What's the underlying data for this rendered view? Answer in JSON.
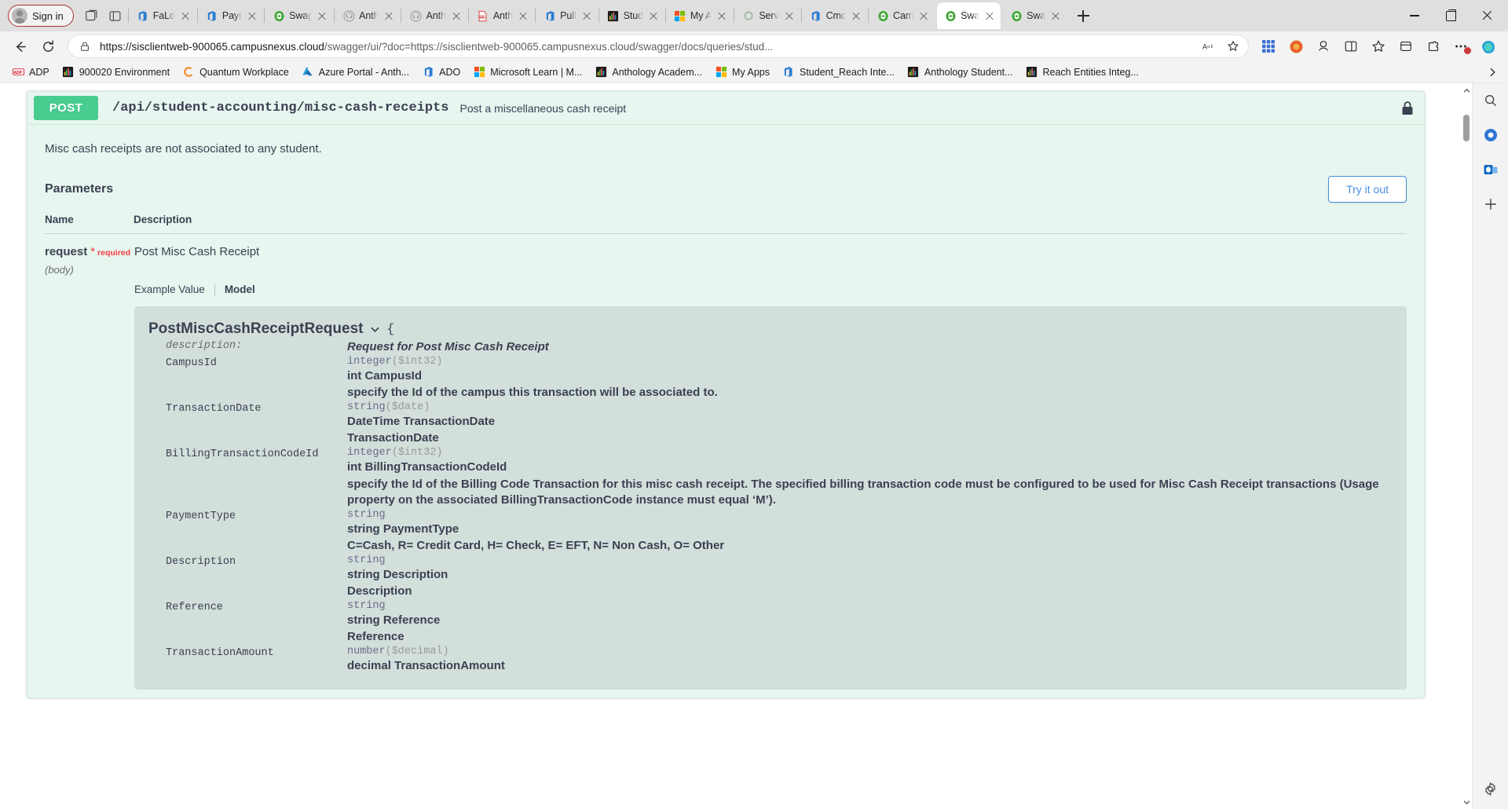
{
  "browser": {
    "signin_label": "Sign in",
    "tabs": [
      {
        "title": "FaLo",
        "favicon": "office-icon",
        "active": false
      },
      {
        "title": "Payr",
        "favicon": "office-icon",
        "active": false
      },
      {
        "title": "Swag",
        "favicon": "swagger-icon",
        "active": false
      },
      {
        "title": "Anth",
        "favicon": "github-icon",
        "active": false
      },
      {
        "title": "Anth",
        "favicon": "github-icon",
        "active": false
      },
      {
        "title": "Anth",
        "favicon": "pdf-icon",
        "active": false
      },
      {
        "title": "Pull",
        "favicon": "office-icon",
        "active": false
      },
      {
        "title": "Stud",
        "favicon": "chart-icon",
        "active": false
      },
      {
        "title": "My A",
        "favicon": "microsoft-icon",
        "active": false
      },
      {
        "title": "Serv",
        "favicon": "servicenow-icon",
        "active": false
      },
      {
        "title": "Cmc",
        "favicon": "office-icon",
        "active": false
      },
      {
        "title": "Cam",
        "favicon": "swagger-icon",
        "active": false
      },
      {
        "title": "Swa",
        "favicon": "swagger-icon",
        "active": true
      },
      {
        "title": "Swa",
        "favicon": "swagger-icon",
        "active": false
      }
    ],
    "newtab_label": "New tab",
    "window_controls": {
      "minimize": "Minimize",
      "maximize": "Restore",
      "close": "Close"
    },
    "nav": {
      "back": "Back",
      "refresh": "Refresh",
      "url_prefix": "https://sisclientweb-900065.campusnexus.cloud",
      "url_suffix": "/swagger/ui/?doc=https://sisclientweb-900065.campusnexus.cloud/swagger/docs/queries/stud...",
      "read_aloud": "Read aloud",
      "favorite": "Add this page to favorites",
      "collections": "Collections",
      "browser_essentials": "Browser essentials",
      "split_screen": "Split screen",
      "favorites": "Favorites",
      "downloads": "Downloads",
      "extensions": "Extensions",
      "settings_more": "Settings and more"
    },
    "bookmarks": [
      {
        "label": "ADP",
        "icon": "adp-icon"
      },
      {
        "label": "900020 Environment",
        "icon": "chart-icon"
      },
      {
        "label": "Quantum Workplace",
        "icon": "quantum-icon"
      },
      {
        "label": "Azure Portal - Anth...",
        "icon": "azure-icon"
      },
      {
        "label": "ADO",
        "icon": "office-icon"
      },
      {
        "label": "Microsoft Learn | M...",
        "icon": "microsoft-icon"
      },
      {
        "label": "Anthology Academ...",
        "icon": "chart-icon"
      },
      {
        "label": "My Apps",
        "icon": "microsoft-icon"
      },
      {
        "label": "Student_Reach Inte...",
        "icon": "office-icon"
      },
      {
        "label": "Anthology Student...",
        "icon": "chart-icon"
      },
      {
        "label": "Reach Entities Integ...",
        "icon": "chart-icon"
      }
    ],
    "bookmarks_overflow": "More bookmarks"
  },
  "swagger": {
    "operation": {
      "method": "POST",
      "path": "/api/student-accounting/misc-cash-receipts",
      "summary": "Post a miscellaneous cash receipt",
      "lock": "authorization-required",
      "note": "Misc cash receipts are not associated to any student."
    },
    "parameters": {
      "title": "Parameters",
      "try_it_out": "Try it out",
      "columns": {
        "name": "Name",
        "description": "Description"
      },
      "rows": [
        {
          "name": "request",
          "required_star": "*",
          "required_text": "required",
          "type": "(body)",
          "description": "Post Misc Cash Receipt"
        }
      ]
    },
    "model_tabs": {
      "example_value": "Example Value",
      "model": "Model",
      "active": "Model"
    },
    "model": {
      "title": "PostMiscCashReceiptRequest",
      "open_brace": "{",
      "properties": [
        {
          "name": "description:",
          "italic_name": true,
          "type": "",
          "format": "",
          "lines": [
            "Request for Post Misc Cash Receipt"
          ],
          "italic_lines": true
        },
        {
          "name": "CampusId",
          "type": "integer",
          "format": "($int32)",
          "lines": [
            "int CampusId",
            "specify the Id of the campus this transaction will be associated to."
          ]
        },
        {
          "name": "TransactionDate",
          "type": "string",
          "format": "($date)",
          "lines": [
            "DateTime TransactionDate",
            "TransactionDate"
          ]
        },
        {
          "name": "BillingTransactionCodeId",
          "type": "integer",
          "format": "($int32)",
          "lines": [
            "int BillingTransactionCodeId",
            "specify the Id of the Billing Code Transaction for this misc cash receipt. The specified billing transaction code must be configured to be used for Misc Cash Receipt transactions (Usage property on the associated BillingTransactionCode instance must equal ‘M’)."
          ]
        },
        {
          "name": "PaymentType",
          "type": "string",
          "format": "",
          "lines": [
            "string PaymentType",
            "C=Cash, R= Credit Card, H= Check, E= EFT, N= Non Cash, O= Other"
          ]
        },
        {
          "name": "Description",
          "type": "string",
          "format": "",
          "lines": [
            "string Description",
            "Description"
          ]
        },
        {
          "name": "Reference",
          "type": "string",
          "format": "",
          "lines": [
            "string Reference",
            "Reference"
          ]
        },
        {
          "name": "TransactionAmount",
          "type": "number",
          "format": "($decimal)",
          "lines": [
            "decimal TransactionAmount"
          ]
        }
      ]
    }
  },
  "colors": {
    "post_green": "#49cc90",
    "opblock_bg": "#e8f6f0",
    "opblock_border": "#cfe9d9",
    "model_bg": "#d3dfdb",
    "link_blue": "#4990e2",
    "required_red": "#f93e3e",
    "text": "#3b4151"
  }
}
